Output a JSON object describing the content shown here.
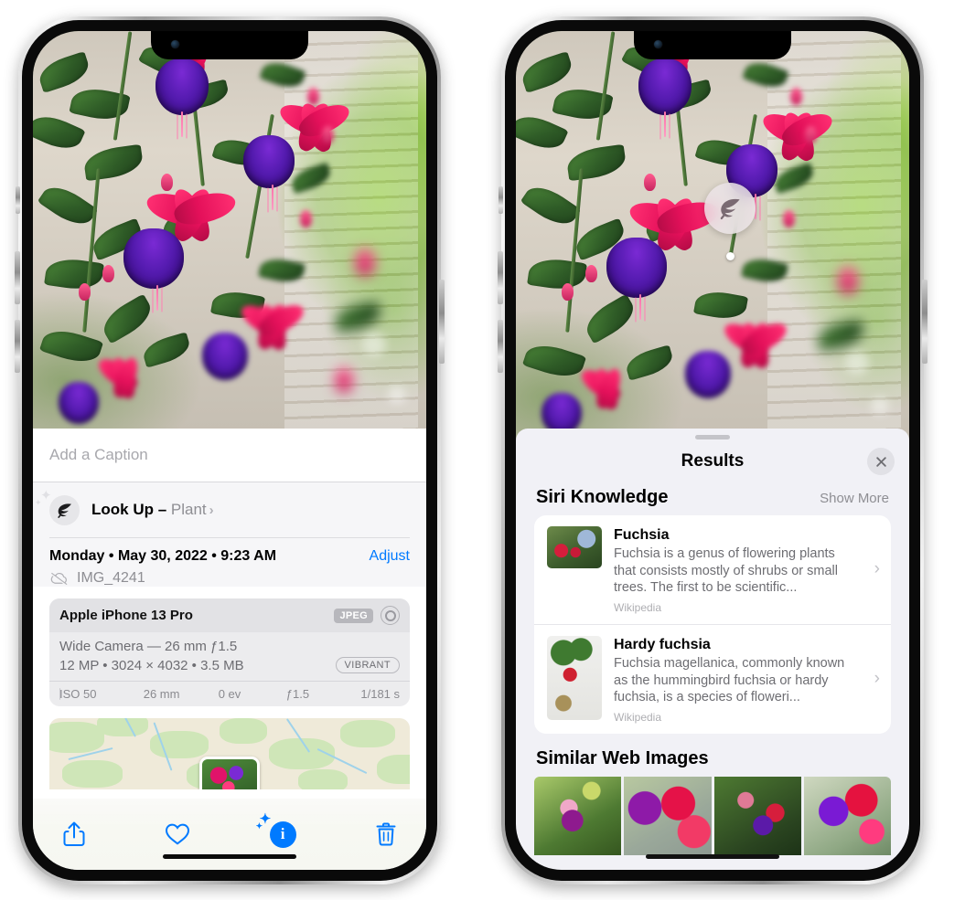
{
  "left_phone": {
    "caption": {
      "placeholder": "Add a Caption",
      "value": ""
    },
    "lookup": {
      "label": "Look Up –",
      "subject": "Plant",
      "chevron": "›",
      "icon": "leaf-icon"
    },
    "meta": {
      "date": "Monday • May 30, 2022 • 9:23 AM",
      "adjust_label": "Adjust",
      "filename": "IMG_4241",
      "cloud_icon": "cloud-slash-icon"
    },
    "camera_card": {
      "model": "Apple iPhone 13 Pro",
      "format_badge": "JPEG",
      "aperture_icon": "aperture-icon",
      "lens_line": "Wide Camera — 26 mm ƒ1.5",
      "specs_line": "12 MP • 3024 × 4032 • 3.5 MB",
      "style_badge": "VIBRANT",
      "exif": [
        "ISO 50",
        "26 mm",
        "0 ev",
        "ƒ1.5",
        "1/181 s"
      ]
    },
    "toolbar": [
      {
        "name": "share-icon",
        "label": "Share"
      },
      {
        "name": "favorite-heart-icon",
        "label": "Favorite"
      },
      {
        "name": "info-sparkle-icon",
        "label": "Info",
        "glyph": "i"
      },
      {
        "name": "trash-icon",
        "label": "Delete"
      }
    ]
  },
  "right_phone": {
    "visual_lookup_badge": {
      "icon": "leaf-icon"
    },
    "sheet": {
      "title": "Results",
      "close_label": "Close",
      "siri_knowledge": {
        "title": "Siri Knowledge",
        "show_more": "Show More",
        "items": [
          {
            "name": "Fuchsia",
            "description": "Fuchsia is a genus of flowering plants that consists mostly of shrubs or small trees. The first to be scientific...",
            "source": "Wikipedia",
            "chevron": "›"
          },
          {
            "name": "Hardy fuchsia",
            "description": "Fuchsia magellanica, commonly known as the hummingbird fuchsia or hardy fuchsia, is a species of floweri...",
            "source": "Wikipedia",
            "chevron": "›"
          }
        ]
      },
      "similar_web_images": {
        "title": "Similar Web Images",
        "thumbnails": [
          "fuchsia-pink-white-bloom",
          "fuchsia-red-closeup",
          "fuchsia-bush-buds",
          "fuchsia-purple-red-cluster"
        ]
      }
    }
  },
  "colors": {
    "accent_blue": "#007aff",
    "sheet_bg": "#f1f1f6",
    "secondary_text": "#8e8e93",
    "card_white": "#ffffff"
  }
}
